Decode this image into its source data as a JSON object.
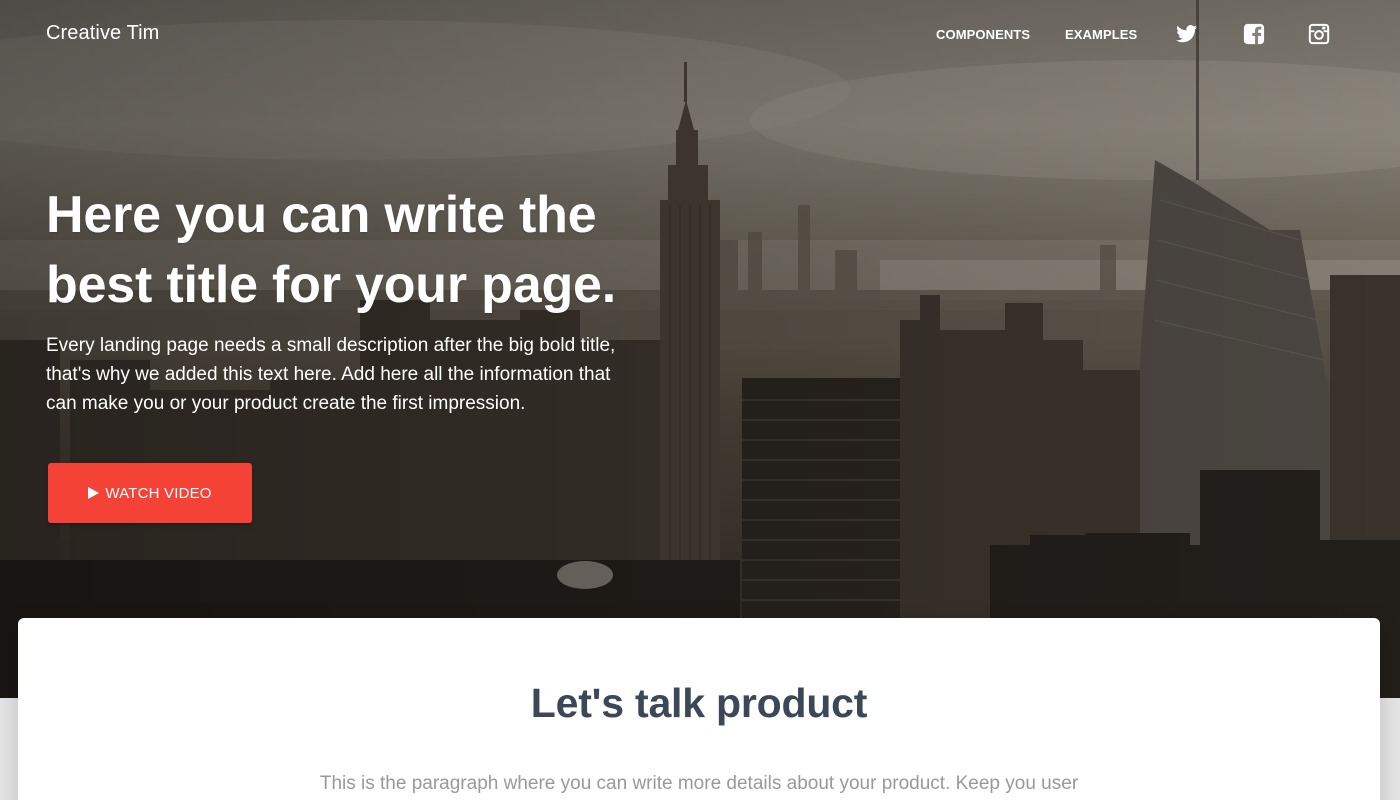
{
  "navbar": {
    "brand": "Creative Tim",
    "links": [
      "COMPONENTS",
      "EXAMPLES"
    ],
    "social_icons": [
      "twitter-icon",
      "facebook-icon",
      "instagram-icon"
    ]
  },
  "hero": {
    "title_line1": "Here you can write the",
    "title_line2": "best title for your page.",
    "description_line1": "Every landing page needs a small description after the big bold title,",
    "description_line2": "that's why we added this text here. Add here all the information that",
    "description_line3": "can make you or your product create the first impression.",
    "button_label": "WATCH VIDEO",
    "button_icon": "play-icon"
  },
  "section": {
    "title": "Let's talk product",
    "paragraph": "This is the paragraph where you can write more details about your product. Keep you user"
  },
  "colors": {
    "accent": "#f44336",
    "title_text": "#3c4858",
    "muted_text": "#999999",
    "white": "#ffffff"
  }
}
